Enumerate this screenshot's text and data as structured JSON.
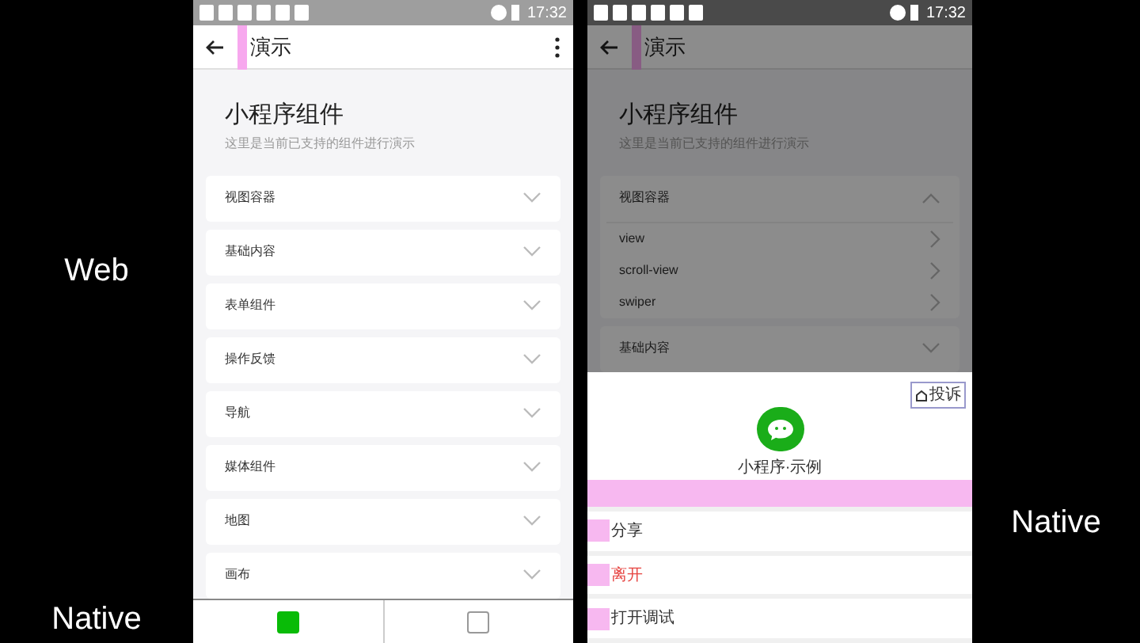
{
  "side_labels": [
    {
      "text": "Web"
    },
    {
      "text": "Native"
    },
    {
      "text": "Native"
    }
  ],
  "left_phone": {
    "time": "17:32",
    "nav_title": "演示",
    "page_title": "小程序组件",
    "page_subtitle": "这里是当前已支持的组件进行演示",
    "sections": [
      {
        "label": "视图容器",
        "expanded": false
      },
      {
        "label": "基础内容",
        "expanded": false
      },
      {
        "label": "表单组件",
        "expanded": false
      },
      {
        "label": "操作反馈",
        "expanded": false
      },
      {
        "label": "导航",
        "expanded": false
      },
      {
        "label": "媒体组件",
        "expanded": false
      },
      {
        "label": "地图",
        "expanded": false
      },
      {
        "label": "画布",
        "expanded": false
      }
    ],
    "tabs": [
      {
        "selected": true
      },
      {
        "selected": false
      }
    ]
  },
  "right_phone": {
    "time": "17:32",
    "nav_title": "演示",
    "page_title": "小程序组件",
    "page_subtitle": "这里是当前已支持的组件进行演示",
    "sections": [
      {
        "label": "视图容器",
        "expanded": true,
        "children": [
          {
            "label": "view"
          },
          {
            "label": "scroll-view"
          },
          {
            "label": "swiper"
          }
        ]
      },
      {
        "label": "基础内容",
        "expanded": false
      }
    ],
    "sheet": {
      "complaint_button": "投诉",
      "app_name": "小程序·示例",
      "actions": [
        {
          "label": "分享",
          "destructive": false
        },
        {
          "label": "离开",
          "destructive": true
        },
        {
          "label": "打开调试",
          "destructive": false
        }
      ]
    }
  }
}
